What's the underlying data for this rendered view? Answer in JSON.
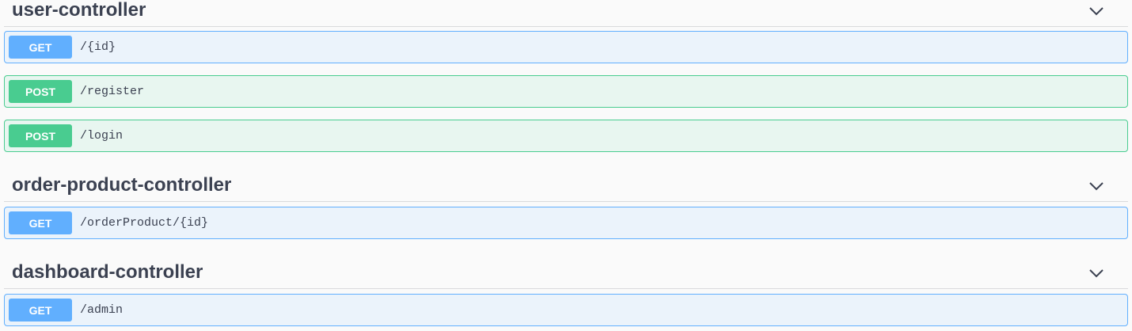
{
  "sections": [
    {
      "title": "user-controller",
      "operations": [
        {
          "method": "GET",
          "path": "/{id}"
        },
        {
          "method": "POST",
          "path": "/register"
        },
        {
          "method": "POST",
          "path": "/login"
        }
      ]
    },
    {
      "title": "order-product-controller",
      "operations": [
        {
          "method": "GET",
          "path": "/orderProduct/{id}"
        }
      ]
    },
    {
      "title": "dashboard-controller",
      "operations": [
        {
          "method": "GET",
          "path": "/admin"
        }
      ]
    }
  ],
  "icons": {
    "expand": "chevron-down-icon"
  },
  "colors": {
    "get": "#61affe",
    "get_bg": "#ebf3fb",
    "post": "#49cc90",
    "post_bg": "#e8f6f0",
    "text": "#3b4151"
  }
}
